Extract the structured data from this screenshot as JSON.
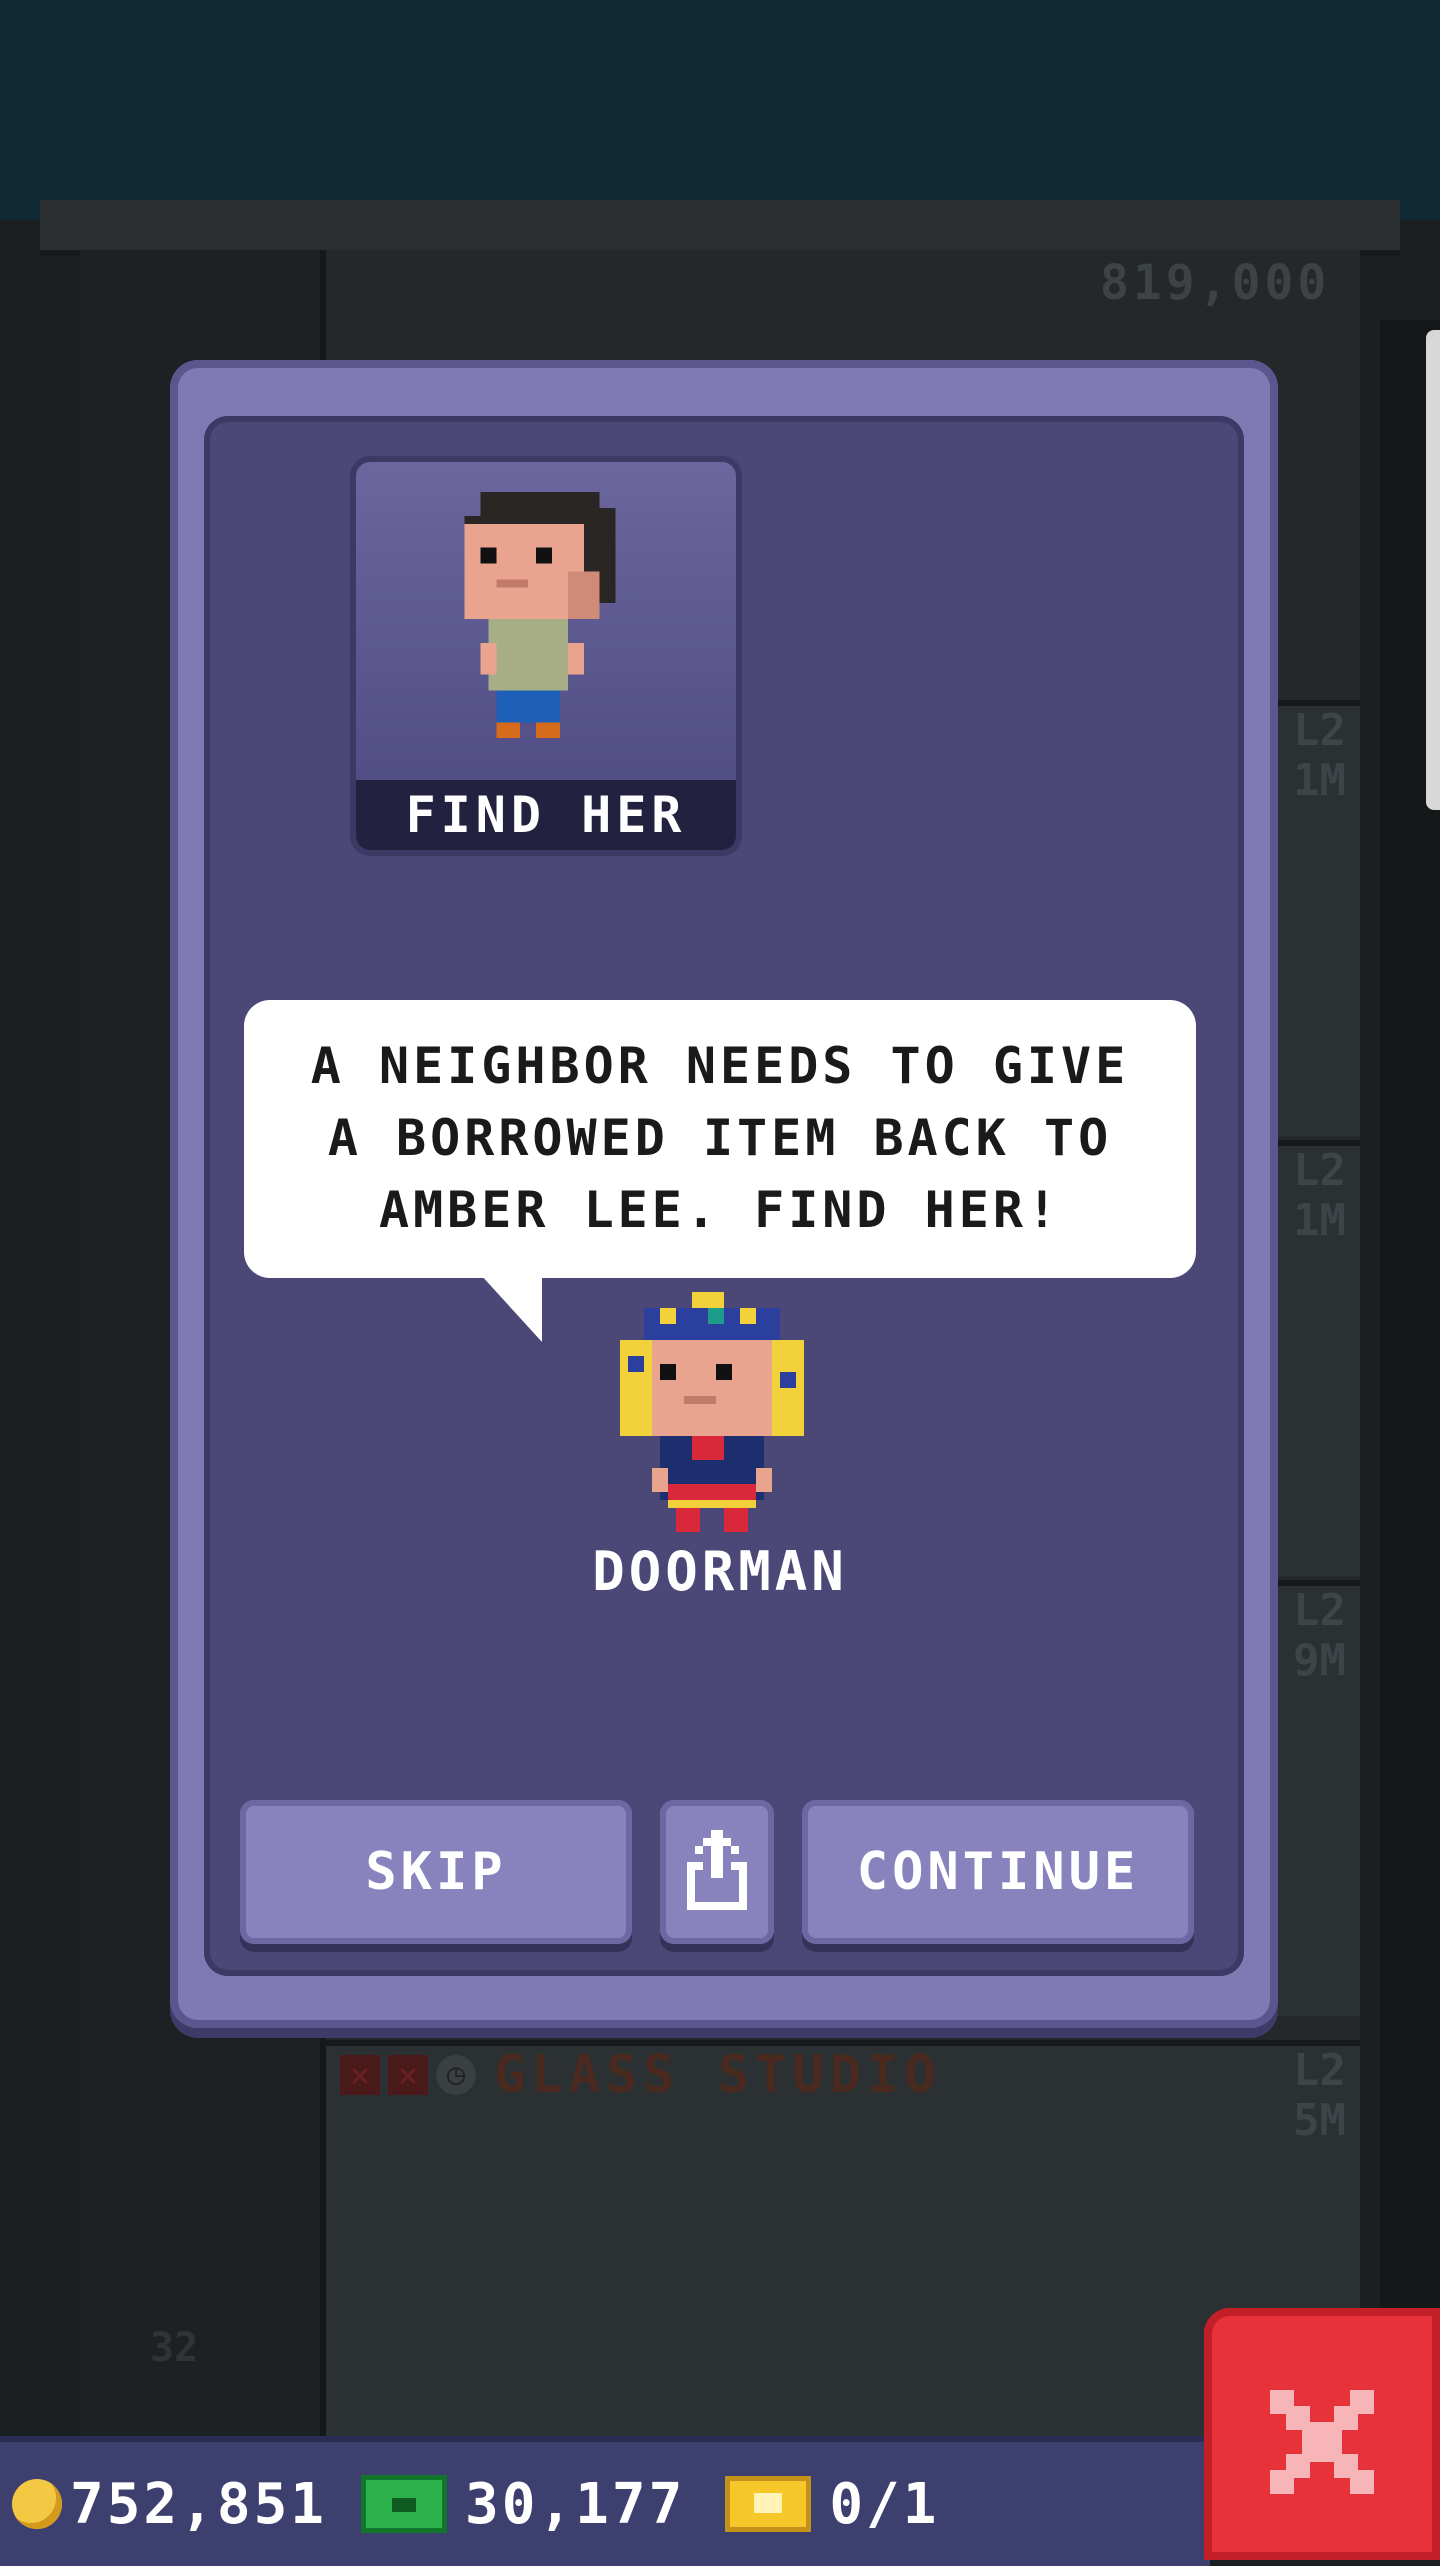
{
  "background": {
    "top_price": "819,000",
    "floor_tags": [
      {
        "level": "L2",
        "value": "1M"
      },
      {
        "level": "L2",
        "value": "1M"
      },
      {
        "level": "L2",
        "value": "9M"
      },
      {
        "level": "L2",
        "value": "5M"
      }
    ],
    "studio_name": "GLASS STUDIO",
    "floor_number": "32"
  },
  "dialog": {
    "portrait_label": "FIND HER",
    "speech_text": "A NEIGHBOR NEEDS TO GIVE\nA BORROWED ITEM BACK TO\nAMBER LEE. FIND HER!",
    "speaker_name": "DOORMAN",
    "buttons": {
      "skip_label": "SKIP",
      "share_icon": "share-icon",
      "continue_label": "CONTINUE"
    }
  },
  "bottom_bar": {
    "coins": "752,851",
    "bux": "30,177",
    "tickets": "0/1"
  },
  "colors": {
    "dialog_frame": "#7f7ab4",
    "dialog_body": "#4b4878",
    "button": "#8883bd",
    "close_button": "#e8323a",
    "coin": "#f3c944",
    "bux": "#2bb24c",
    "ticket": "#f6c729"
  }
}
